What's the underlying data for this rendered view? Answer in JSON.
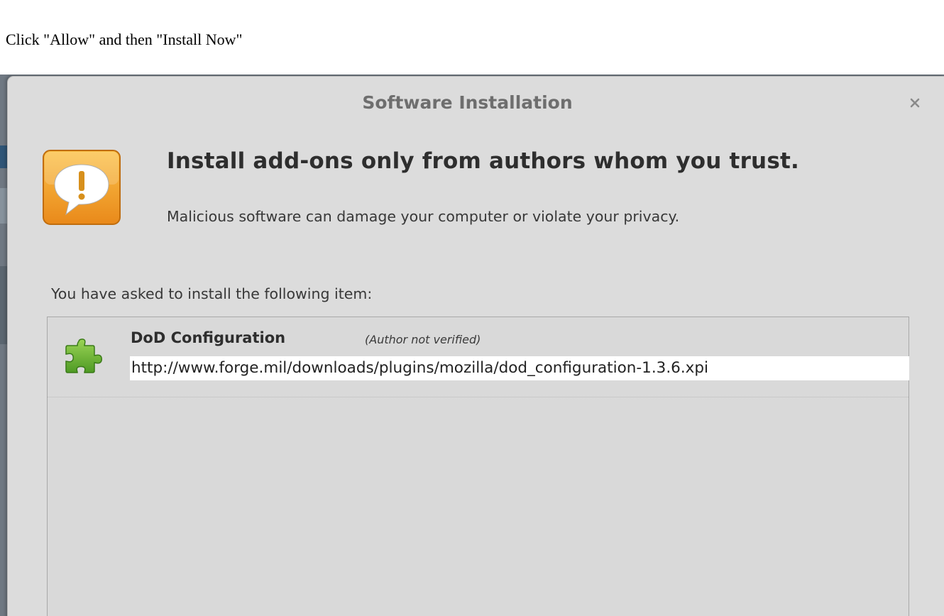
{
  "instruction": "Click \"Allow\" and then \"Install Now\"",
  "dialog": {
    "title": "Software Installation",
    "close_icon": "close-icon",
    "warning_icon": "speech-bubble-warning-icon",
    "headline": "Install add-ons only from authors whom you trust.",
    "subline": "Malicious software can damage your computer or violate your privacy.",
    "asked_label": "You have asked to install the following item:",
    "items": [
      {
        "icon": "puzzle-piece-icon",
        "name": "DoD Configuration",
        "author_note": "(Author not verified)",
        "url": "http://www.forge.mil/downloads/plugins/mozilla/dod_configuration-1.3.6.xpi"
      }
    ]
  },
  "colors": {
    "dialog_bg": "#dcdcdc",
    "warning_orange": "#f0a020",
    "puzzle_green": "#6fb534"
  }
}
